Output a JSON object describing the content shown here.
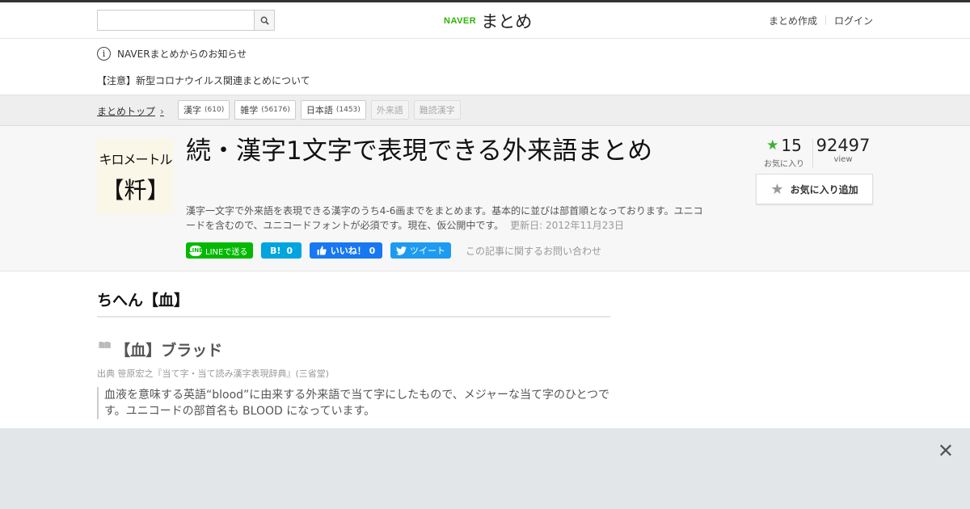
{
  "header": {
    "search_placeholder": "",
    "logo_brand": "NAVER",
    "logo_name": "まとめ",
    "nav": {
      "create": "まとめ作成",
      "login": "ログイン"
    }
  },
  "notice": {
    "title": "NAVERまとめからのお知らせ",
    "item": "【注意】新型コロナウイルス関連まとめについて"
  },
  "breadcrumb": {
    "top": "まとめトップ",
    "tags": [
      {
        "label": "漢字",
        "count": "(610)"
      },
      {
        "label": "雑学",
        "count": "(56176)"
      },
      {
        "label": "日本語",
        "count": "(1453)"
      },
      {
        "label": "外来語",
        "count": ""
      },
      {
        "label": "難読漢字",
        "count": ""
      }
    ]
  },
  "article": {
    "thumb_line1": "キロメートル",
    "thumb_line2": "【粁】",
    "title": "続・漢字1文字で表現できる外来語まとめ",
    "description": "漢字一文字で外来語を表現できる漢字のうち4-6画までをまとめます。基本的に並びは部首順となっております。ユニコードを含むので、ユニコードフォントが必須です。現在、仮公開中です。",
    "updated": "更新日: 2012年11月23日",
    "favorites": "15",
    "favorites_label": "お気に入り",
    "views": "92497",
    "views_label": "view",
    "fav_button": "お気に入り追加"
  },
  "share": {
    "line": "LINEで送る",
    "hatena_count": "0",
    "facebook": "いいね！ 0",
    "twitter": "ツイート",
    "contact": "この記事に関するお問い合わせ"
  },
  "content": {
    "heading": "ちへん【血】",
    "quote_title": "【血】ブラッド",
    "source": "出典  笹原宏之『当て字・当て読み漢字表現辞典』(三省堂)",
    "body": "血液を意味する英語“blood”に由来する外来語で当て字にしたもので、メジャーな当て字のひとつです。ユニコードの部首名も BLOOD になっています。"
  },
  "colors": {
    "naver_green": "#2db400",
    "line_green": "#00b900",
    "facebook": "#1877f2",
    "twitter": "#1d9bf0",
    "hatena": "#00a4de"
  }
}
